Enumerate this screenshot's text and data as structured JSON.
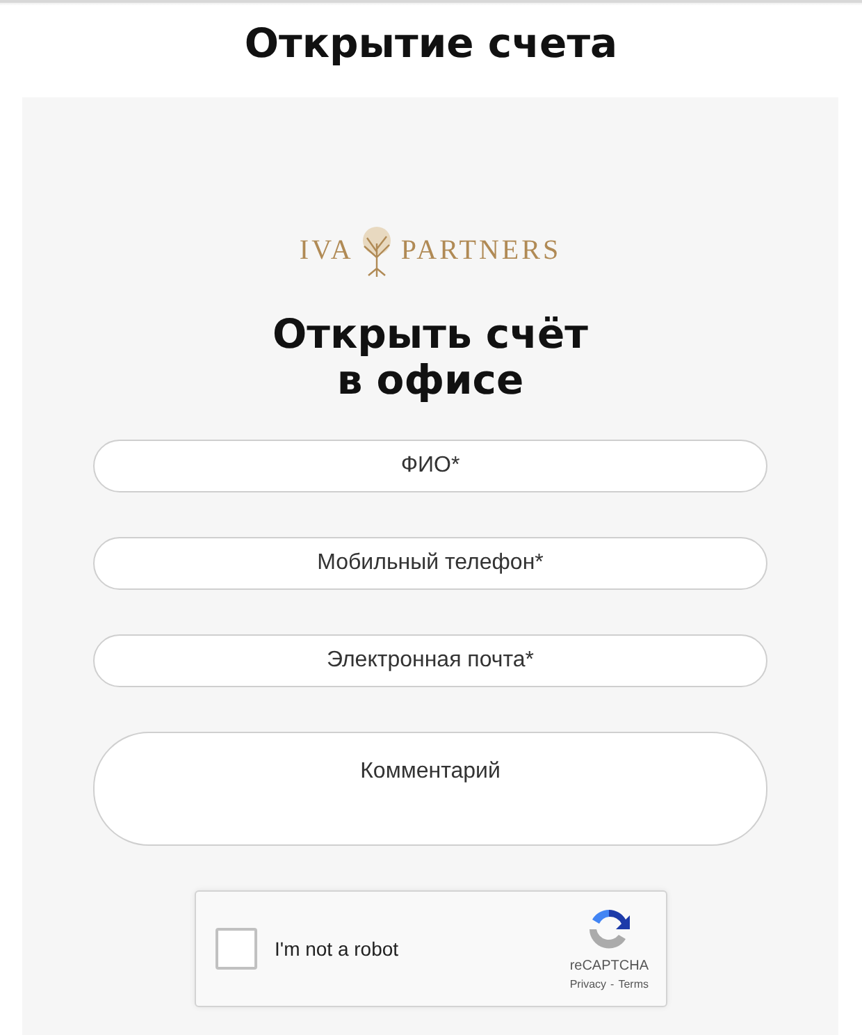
{
  "title": "Открытие счета",
  "logo": {
    "left": "IVA",
    "right": "PARTNERS"
  },
  "heading": [
    "Открыть счёт",
    "в офисе"
  ],
  "fields": [
    {
      "kind": "input",
      "placeholder": "ФИО*"
    },
    {
      "kind": "input",
      "placeholder": "Мобильный телефон*"
    },
    {
      "kind": "input",
      "placeholder": "Электронная почта*"
    },
    {
      "kind": "textarea",
      "placeholder": "Комментарий"
    }
  ],
  "captcha": {
    "label": "I'm not a robot",
    "checked": false,
    "brand": "reCAPTCHA",
    "privacy": "Privacy",
    "separator": "-",
    "terms": "Terms"
  }
}
